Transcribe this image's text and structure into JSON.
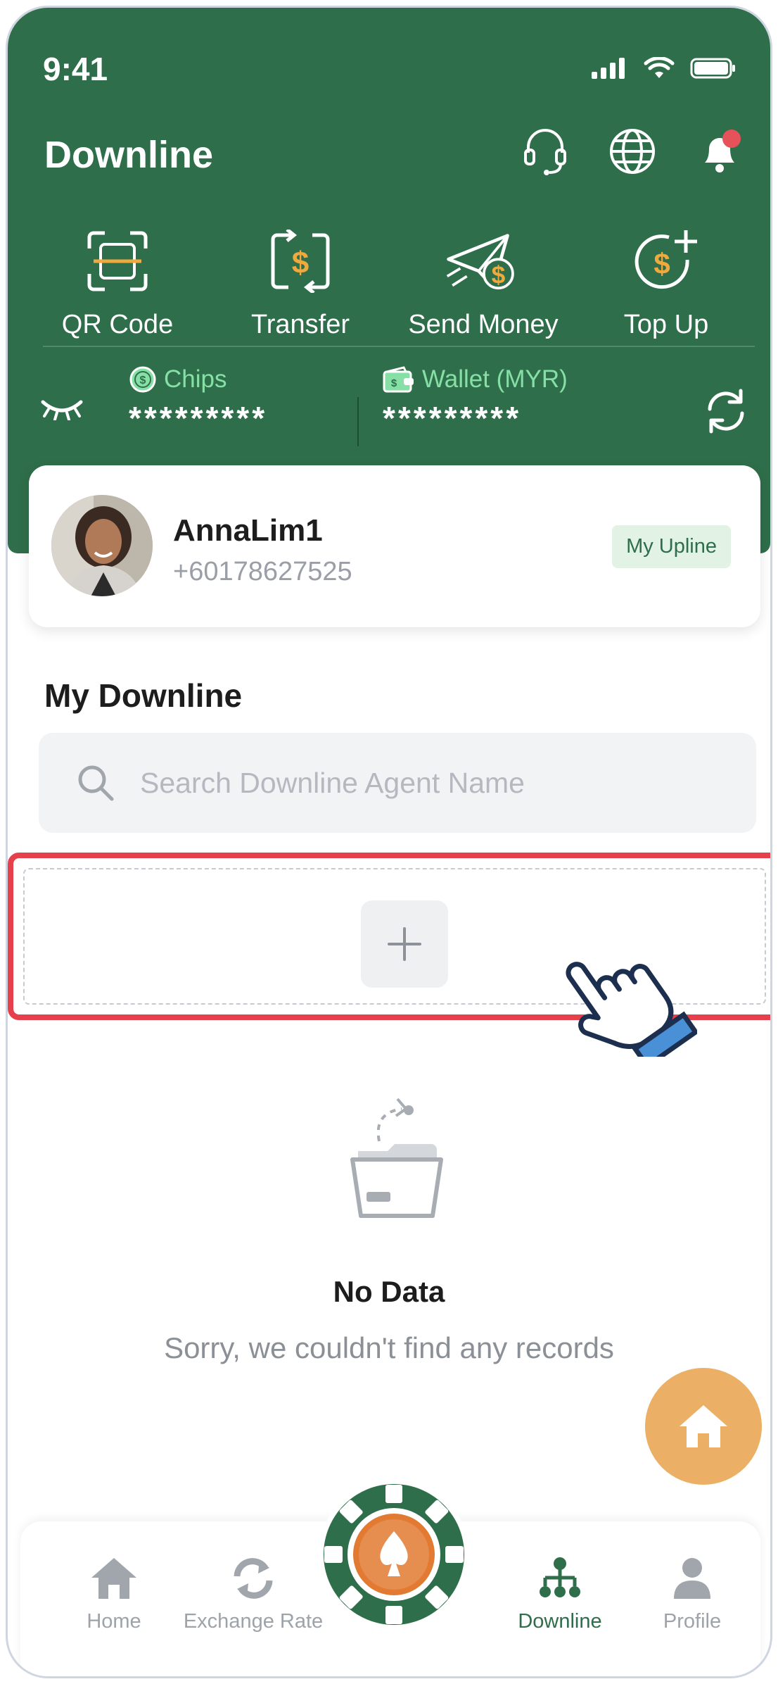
{
  "status_bar": {
    "time": "9:41"
  },
  "header": {
    "title": "Downline"
  },
  "actions": [
    {
      "label": "QR Code",
      "icon": "qr-scan-icon"
    },
    {
      "label": "Transfer",
      "icon": "transfer-icon"
    },
    {
      "label": "Send Money",
      "icon": "send-money-icon"
    },
    {
      "label": "Top Up",
      "icon": "top-up-icon"
    }
  ],
  "balance": {
    "chips_label": "Chips",
    "chips_value": "*********",
    "wallet_label": "Wallet (MYR)",
    "wallet_value": "*********"
  },
  "profile": {
    "name": "AnnaLim1",
    "phone": "+60178627525",
    "badge": "My Upline"
  },
  "downline": {
    "section_title": "My Downline",
    "search_placeholder": "Search Downline Agent Name"
  },
  "empty_state": {
    "title": "No Data",
    "subtitle": "Sorry, we couldn't find any records"
  },
  "tabs": [
    {
      "label": "Home",
      "active": false
    },
    {
      "label": "Exchange Rate",
      "active": false
    },
    {
      "label": "Downline",
      "active": true
    },
    {
      "label": "Profile",
      "active": false
    }
  ],
  "colors": {
    "primary_green": "#2f6e4a",
    "accent_gold": "#f0a93d",
    "highlight_red": "#e5404b",
    "fab_orange": "#ebb065"
  }
}
